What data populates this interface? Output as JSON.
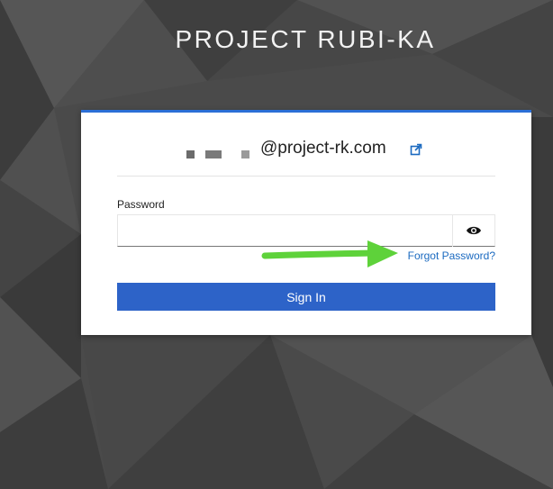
{
  "brand": {
    "title": "PROJECT RUBI-KA"
  },
  "login": {
    "username_domain": "@project-rk.com",
    "password_label": "Password",
    "password_value": "",
    "forgot_link": "Forgot Password?",
    "signin_label": "Sign In"
  },
  "icons": {
    "external": "external-link-icon",
    "eye": "eye-icon",
    "annotation": "green-arrow-annotation"
  },
  "colors": {
    "accent": "#2d63c8",
    "link": "#1b6ac0",
    "annotation_arrow": "#5ed23a",
    "background": "#4a4a4a"
  }
}
